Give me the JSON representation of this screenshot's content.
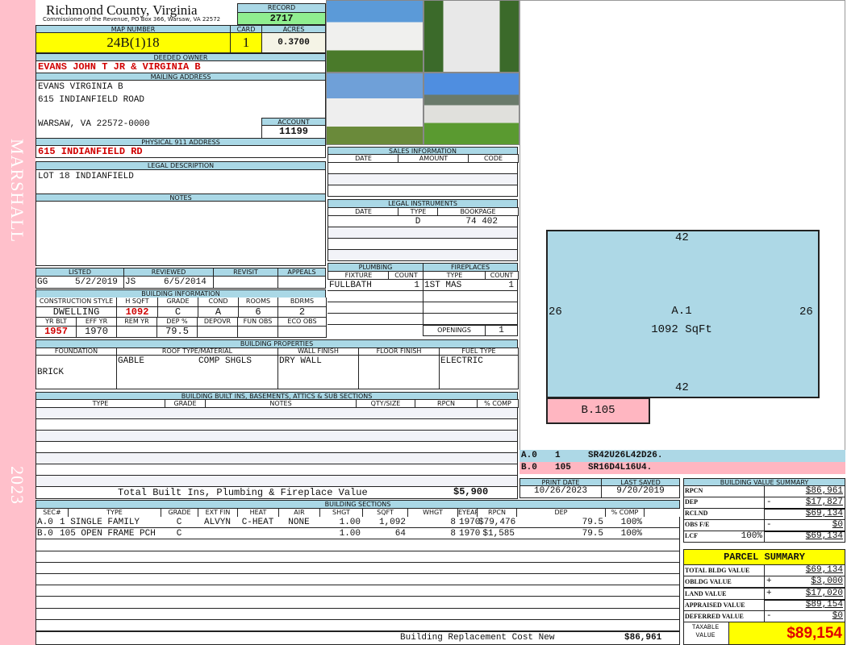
{
  "sidebar": {
    "district": "MARSHALL",
    "year": "2023"
  },
  "header": {
    "title": "Richmond County, Virginia",
    "subtitle": "Commissioner of the Revenue, PO Box 366, Warsaw, VA 22572",
    "record_label": "RECORD",
    "record": "2717"
  },
  "parcel": {
    "map_label": "MAP NUMBER",
    "map": "24B(1)18",
    "card_label": "CARD",
    "card": "1",
    "acres_label": "ACRES",
    "acres": "0.3700"
  },
  "owner": {
    "label": "DEEDED OWNER",
    "value": "EVANS JOHN T JR & VIRGINIA B"
  },
  "mailing": {
    "label": "MAILING ADDRESS",
    "line1": "EVANS VIRGINIA B",
    "line2": "615 INDIANFIELD ROAD",
    "line3": "WARSAW, VA 22572-0000",
    "account_label": "ACCOUNT",
    "account": "11199"
  },
  "physical": {
    "label": "PHYSICAL 911 ADDRESS",
    "value": "615 INDIANFIELD RD"
  },
  "legal": {
    "label": "LEGAL DESCRIPTION",
    "value": "LOT 18 INDIANFIELD"
  },
  "notes": {
    "label": "NOTES"
  },
  "review": {
    "listed_label": "LISTED",
    "listed_by": "GG",
    "listed_date": "5/2/2019",
    "reviewed_label": "REVIEWED",
    "reviewed_by": "JS",
    "reviewed_date": "6/5/2014",
    "revisit_label": "REVISIT",
    "appeals_label": "APPEALS"
  },
  "building_info": {
    "label": "BUILDING INFORMATION",
    "h1": [
      "CONSTRUCTION STYLE",
      "H SQFT",
      "GRADE",
      "COND",
      "ROOMS",
      "BDRMS"
    ],
    "v1": [
      "DWELLING",
      "1092",
      "C",
      "A",
      "6",
      "2"
    ],
    "h2": [
      "YR BLT",
      "EFF YR",
      "REM YR",
      "DEP %",
      "DEPOVR",
      "FUN OBS",
      "ECO OBS"
    ],
    "v2": [
      "1957",
      "1970",
      "",
      "79.5",
      "",
      "",
      ""
    ]
  },
  "properties": {
    "label": "BUILDING PROPERTIES",
    "headers": [
      "FOUNDATION",
      "ROOF TYPE/MATERIAL",
      "WALL FINISH",
      "FLOOR FINISH",
      "FUEL TYPE"
    ],
    "foundation": "BRICK",
    "roof_type": "GABLE",
    "roof_material": "COMP SHGLS",
    "wall": "DRY WALL",
    "floor": "",
    "fuel": "ELECTRIC"
  },
  "builtins": {
    "label": "BUILDING BUILT INS, BASEMENTS, ATTICS & SUB SECTIONS",
    "headers": [
      "TYPE",
      "GRADE",
      "NOTES",
      "QTY/SIZE",
      "RPCN",
      "% COMP"
    ],
    "total_label": "Total Built Ins, Plumbing & Fireplace Value",
    "total": "$5,900"
  },
  "sections": {
    "label": "BUILDING SECTIONS",
    "headers": [
      "SEC#",
      "TYPE",
      "GRADE",
      "EXT FIN",
      "HEAT",
      "AIR",
      "SHGT",
      "SQFT",
      "WHGT",
      "EYEAR",
      "RPCN",
      "DEP",
      "% COMP"
    ],
    "rows": [
      [
        "A.0",
        "1 SINGLE FAMILY",
        "C",
        "ALVYN",
        "C-HEAT",
        "NONE",
        "1.00",
        "1,092",
        "8",
        "1970",
        "$79,476",
        "79.5",
        "100%"
      ],
      [
        "B.0",
        "105 OPEN FRAME PCH",
        "C",
        "",
        "",
        "",
        "1.00",
        "64",
        "8",
        "1970",
        "$1,585",
        "79.5",
        "100%"
      ]
    ],
    "total_label": "Building Replacement Cost New",
    "total": "$86,961"
  },
  "sales": {
    "label": "SALES INFORMATION",
    "headers": [
      "DATE",
      "AMOUNT",
      "CODE"
    ]
  },
  "instruments": {
    "label": "LEGAL INSTRUMENTS",
    "headers": [
      "DATE",
      "TYPE",
      "BOOKPAGE"
    ],
    "rows": [
      [
        "",
        "D",
        "74 402"
      ]
    ]
  },
  "plumbing": {
    "label": "PLUMBING",
    "headers": [
      "FIXTURE",
      "COUNT"
    ],
    "rows": [
      [
        "FULLBATH",
        "1"
      ]
    ]
  },
  "fireplaces": {
    "label": "FIREPLACES",
    "headers": [
      "TYPE",
      "COUNT"
    ],
    "rows": [
      [
        "1ST MAS",
        "1"
      ]
    ],
    "openings_label": "OPENINGS",
    "openings": "1"
  },
  "sketch": {
    "top": "42",
    "bottom": "42",
    "left": "26",
    "right": "26",
    "area_label": "A.1",
    "area_sqft": "1092 SqFt",
    "porch_label": "B.105",
    "lines": [
      [
        "A.0",
        "1",
        "SR42U26L42D26."
      ],
      [
        "B.0",
        "105",
        "SR16D4L16U4."
      ]
    ]
  },
  "dates": {
    "print_label": "PRINT DATE",
    "print": "10/26/2023",
    "saved_label": "LAST SAVED",
    "saved": "9/20/2019"
  },
  "value_summary": {
    "label": "BUILDING VALUE SUMMARY",
    "rows": [
      [
        "RPCN",
        "",
        "",
        "$86,961"
      ],
      [
        "DEP",
        "",
        "-",
        "$17,827"
      ],
      [
        "RCLND",
        "",
        "",
        "$69,134"
      ],
      [
        "OBS F/E",
        "",
        "-",
        "$0"
      ],
      [
        "LCF",
        "100%",
        "",
        "$69,134"
      ]
    ]
  },
  "parcel_summary": {
    "label": "PARCEL SUMMARY",
    "rows": [
      [
        "TOTAL BLDG VALUE",
        "",
        "$69,134"
      ],
      [
        "OBLDG VALUE",
        "+",
        "$3,000"
      ],
      [
        "LAND VALUE",
        "+",
        "$17,020"
      ],
      [
        "APPRAISED VALUE",
        "",
        "$89,154"
      ],
      [
        "DEFERRED VALUE",
        "-",
        "$0"
      ]
    ],
    "taxable_label": "TAXABLE VALUE",
    "taxable": "$89,154"
  }
}
